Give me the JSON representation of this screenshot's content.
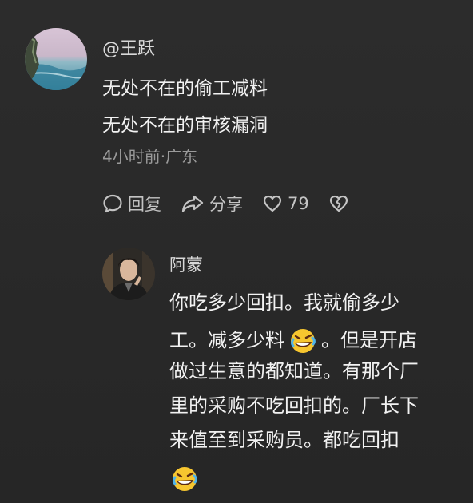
{
  "comment": {
    "author": "@王跃",
    "lines": [
      "无处不在的偷工减料",
      "无处不在的审核漏洞"
    ],
    "meta": "4小时前·广东",
    "actions": {
      "reply_label": "回复",
      "share_label": "分享",
      "like_count": "79"
    },
    "avatar_icon": "avatar-seascape-cliff"
  },
  "reply": {
    "author": "阿蒙",
    "avatar_icon": "avatar-man-portrait",
    "lines": [
      "你吃多少回扣。我就偷多少",
      "工。减多少料",
      "。但是开店",
      "做过生意的都知道。有那个厂",
      "里的采购不吃回扣的。厂长下",
      "来值至到采购员。都吃回扣"
    ],
    "emoji_icon": "rolling-on-floor-laughing-emoji"
  },
  "colors": {
    "background": "#2a2a2a",
    "primary_text": "#f2f2f2",
    "secondary_text": "#9a9a9a",
    "icon": "#c4c4c4"
  }
}
